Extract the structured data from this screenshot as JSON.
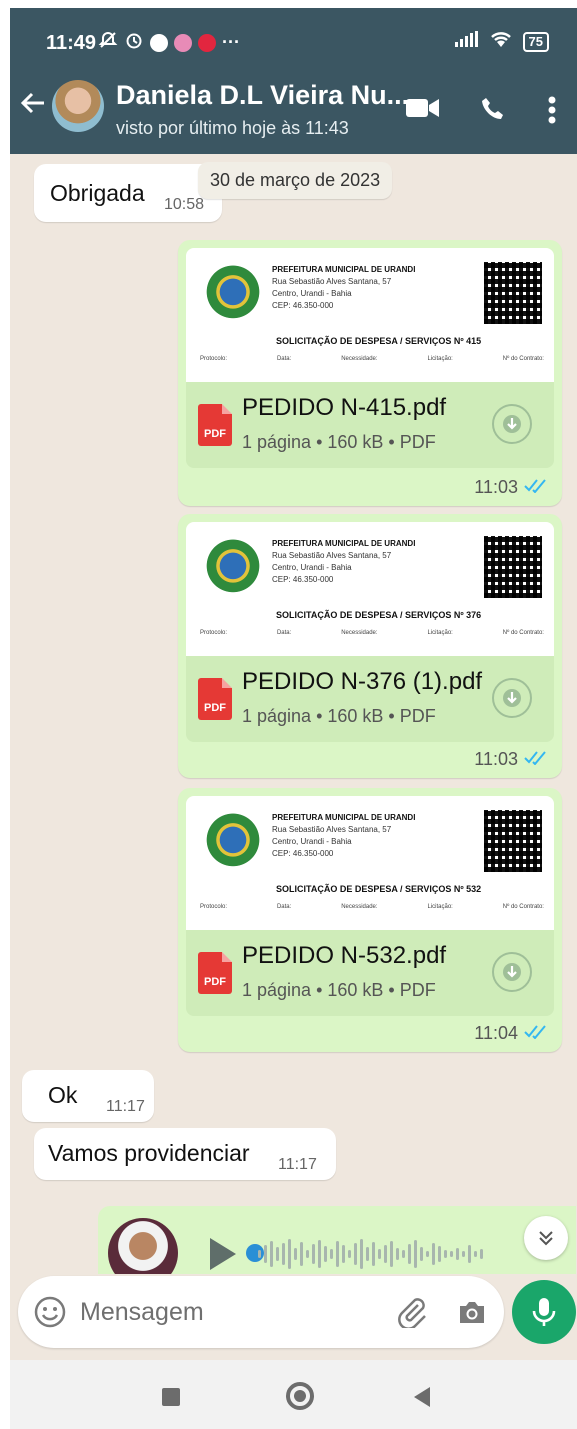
{
  "status_bar": {
    "time": "11:49",
    "more": "···",
    "battery": "75"
  },
  "header": {
    "contact_name": "Daniela D.L Vieira Nu...",
    "contact_status": "visto por último hoje às 11:43"
  },
  "chat": {
    "date_chip": "30 de março de 2023",
    "incoming_top": {
      "text": "Obrigada",
      "time": "10:58"
    },
    "documents": [
      {
        "file_name": "PEDIDO N-415.pdf",
        "meta": "1 página • 160 kB • PDF",
        "time": "11:03",
        "preview_title": "SOLICITAÇÃO DE DESPESA / SERVIÇOS Nº 415"
      },
      {
        "file_name": "PEDIDO N-376 (1).pdf",
        "meta": "1 página • 160 kB • PDF",
        "time": "11:03",
        "preview_title": "SOLICITAÇÃO DE DESPESA / SERVIÇOS Nº 376"
      },
      {
        "file_name": "PEDIDO N-532.pdf",
        "meta": "1 página • 160 kB • PDF",
        "time": "11:04",
        "preview_title": "SOLICITAÇÃO DE DESPESA / SERVIÇOS Nº 532"
      }
    ],
    "preview_header": {
      "line1": "PREFEITURA MUNICIPAL DE URANDI",
      "line2": "Rua Sebastião Alves Santana, 57",
      "line3": "Centro, Urandi - Bahia",
      "line4": "CEP: 46.350-000"
    },
    "preview_fields": [
      "Protocolo:",
      "Data:",
      "Necessidade:",
      "Licitação:",
      "Nº do Contrato:"
    ],
    "pdf_label": "PDF",
    "incoming_ok": {
      "text": "Ok",
      "time": "11:17"
    },
    "incoming_vamos": {
      "text": "Vamos providenciar",
      "time": "11:17"
    }
  },
  "input_bar": {
    "placeholder": "Mensagem"
  },
  "colors": {
    "header_bg": "#3b5662",
    "chat_bg": "#efe7de",
    "outgoing_bubble": "#dbf6c6",
    "accent_green": "#1aa66a",
    "read_ticks": "#34b7f1",
    "pdf_red": "#e53935"
  },
  "icons": {
    "back": "arrow-left-icon",
    "video": "video-camera-icon",
    "call": "phone-icon",
    "menu": "more-vert-icon",
    "download": "download-icon",
    "emoji": "emoji-icon",
    "attach": "paperclip-icon",
    "camera": "camera-icon",
    "mic": "microphone-icon"
  }
}
